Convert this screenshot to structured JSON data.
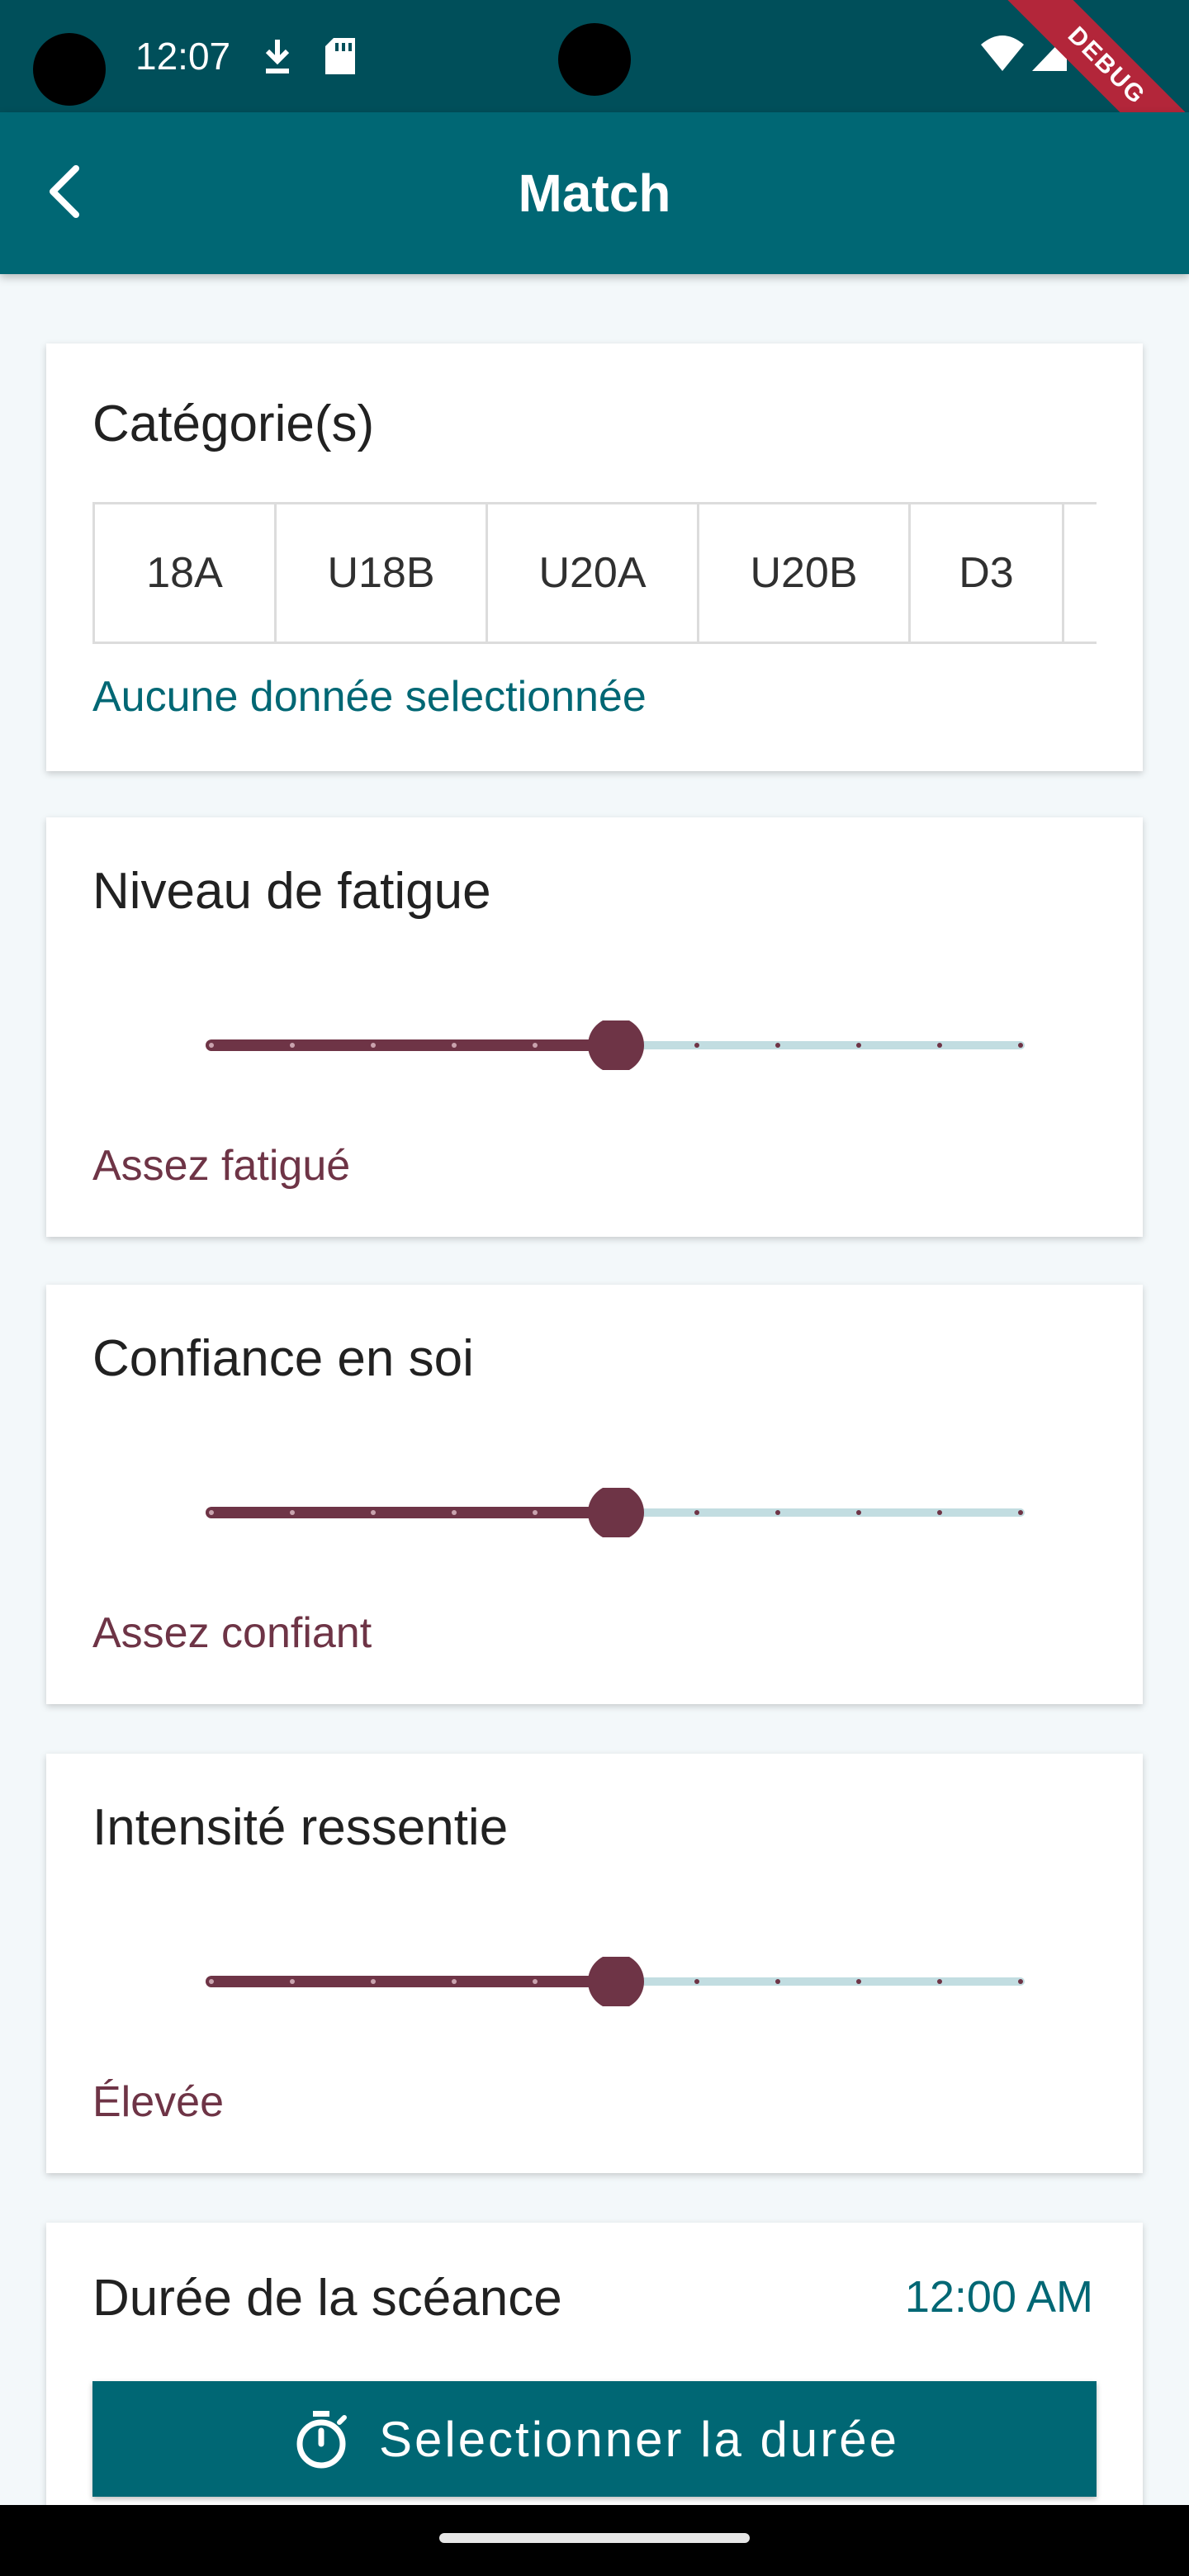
{
  "status_bar": {
    "time": "12:07",
    "debug_label": "DEBUG",
    "icons": [
      "download-icon",
      "sd-card-icon",
      "wifi-icon",
      "cellular-icon"
    ]
  },
  "app_bar": {
    "title": "Match",
    "back_icon": "back-arrow-icon"
  },
  "categories": {
    "title": "Catégorie(s)",
    "chips": [
      "18A",
      "U18B",
      "U20A",
      "U20B",
      "D3",
      ""
    ],
    "empty_text": "Aucune donnée selectionnée"
  },
  "fatigue": {
    "title": "Niveau de fatigue",
    "value_label": "Assez fatigué",
    "level": 5,
    "max": 10
  },
  "confidence": {
    "title": "Confiance en soi",
    "value_label": "Assez confiant",
    "level": 5,
    "max": 10
  },
  "intensity": {
    "title": "Intensité ressentie",
    "value_label": "Élevée",
    "level": 5,
    "max": 10
  },
  "duration": {
    "title": "Durée de la scéance",
    "time": "12:00 AM",
    "button_label": "Selectionner la durée",
    "button_icon": "timer-icon"
  },
  "colors": {
    "primary": "#006774",
    "status_bar": "#004f5a",
    "accent": "#6e3446",
    "slider_track_inactive": "#c2dde1"
  }
}
